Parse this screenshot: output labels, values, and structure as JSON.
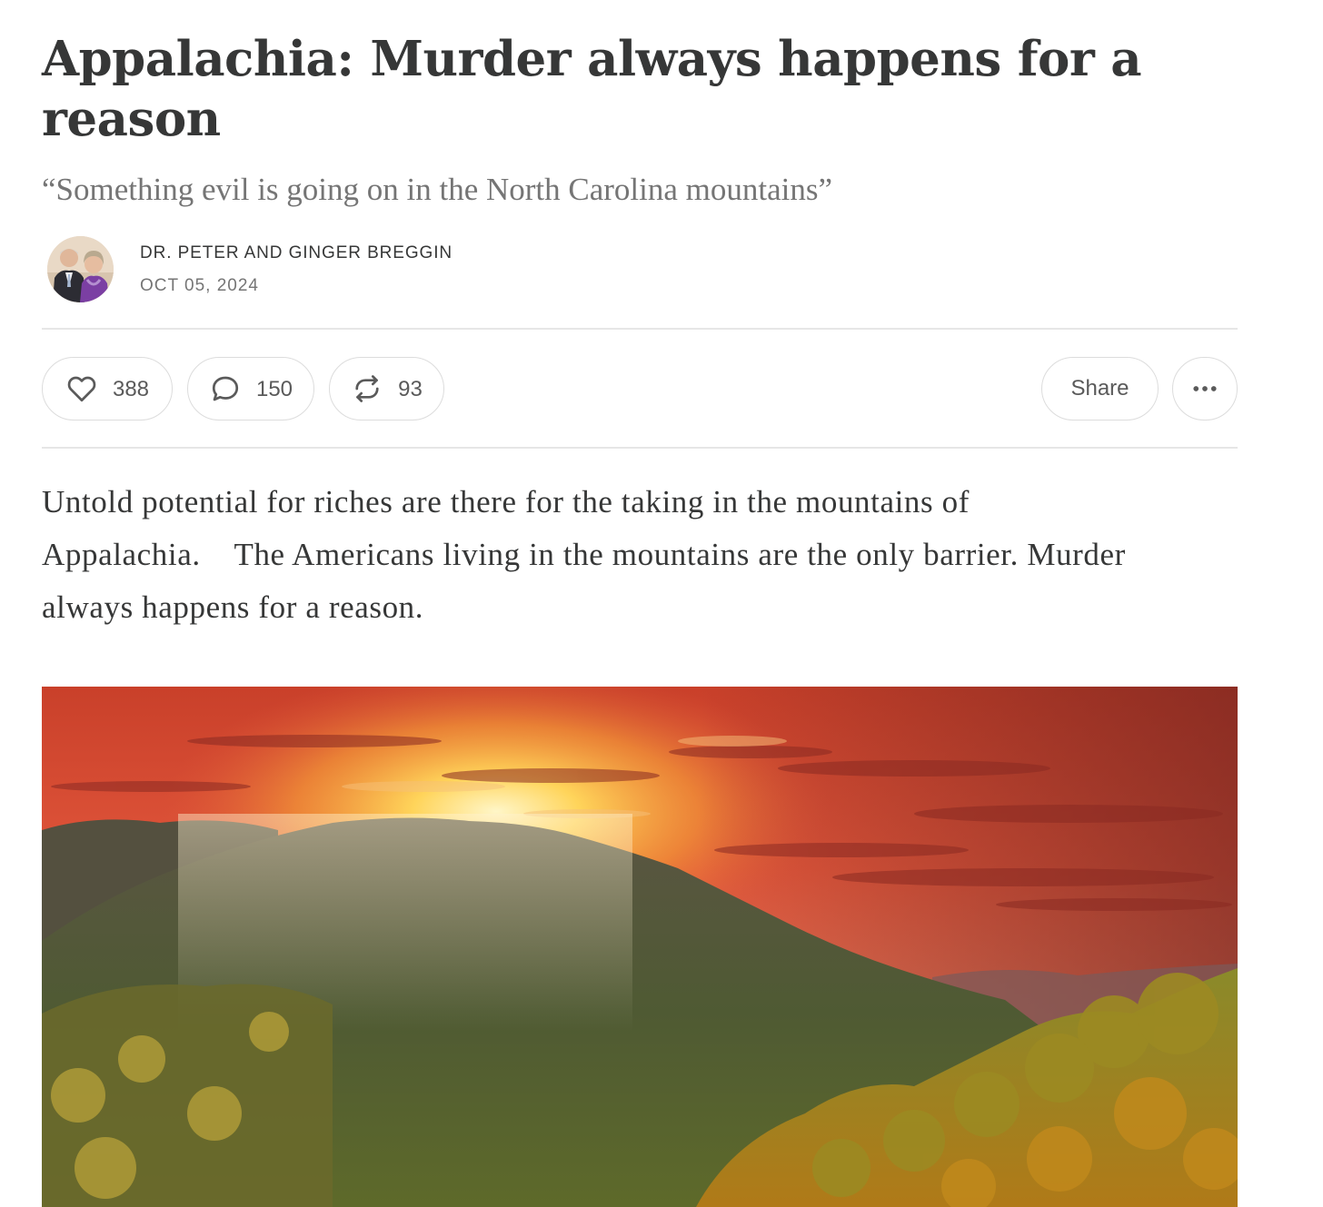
{
  "post": {
    "title": "Appalachia: Murder always happens for a reason",
    "subtitle": "“Something evil is going on in the North Carolina mountains”",
    "author": "DR. PETER AND GINGER BREGGIN",
    "date": "OCT 05, 2024",
    "body": "Untold potential for riches are there for the taking in the mountains of\nAppalachia.    The Americans living in the mountains are the only barrier. Murder\nalways happens for a reason."
  },
  "actions": {
    "likes": "388",
    "comments": "150",
    "restacks": "93",
    "share_label": "Share",
    "more_icon": "ellipsis-icon",
    "like_icon": "heart-icon",
    "comment_icon": "comment-bubble-icon",
    "restack_icon": "restack-arrows-icon"
  },
  "colors": {
    "text": "#363737",
    "muted": "#757575",
    "border": "#dcdcdc"
  }
}
